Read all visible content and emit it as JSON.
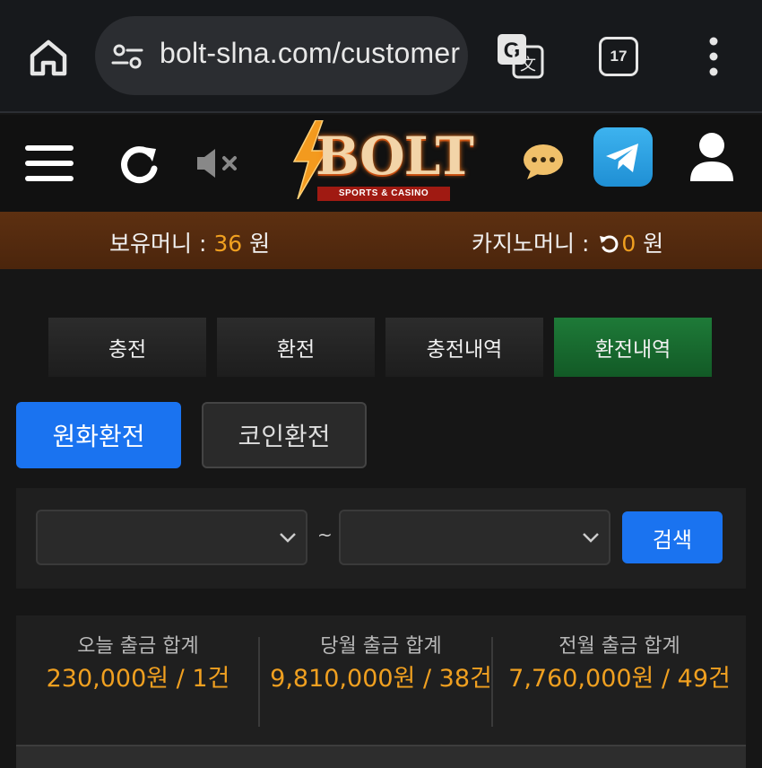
{
  "browser": {
    "url": "bolt-slna.com/customer",
    "tab_count": "17"
  },
  "header": {
    "logo_text": "BOLT",
    "logo_sub": "SPORTS & CASINO"
  },
  "balance": {
    "money_label": "보유머니 : ",
    "money_value": "36",
    "money_unit": " 원",
    "casino_label": "카지노머니 : ",
    "casino_value": "0",
    "casino_unit": " 원"
  },
  "tabs": [
    {
      "label": "충전"
    },
    {
      "label": "환전"
    },
    {
      "label": "충전내역"
    },
    {
      "label": "환전내역"
    }
  ],
  "active_tab": "환전내역",
  "subtabs": {
    "won": "원화환전",
    "coin": "코인환전"
  },
  "filter": {
    "from_value": "",
    "to_value": "",
    "separator": "~",
    "search_label": "검색"
  },
  "stats": [
    {
      "label": "오늘 출금 합계",
      "value": "230,000원 / 1건"
    },
    {
      "label": "당월 출금 합계",
      "value": "9,810,000원 / 38건"
    },
    {
      "label": "전월 출금 합계",
      "value": "7,760,000원 / 49건"
    }
  ],
  "colors": {
    "accent_blue": "#1a73f0",
    "active_green": "#1e7a38",
    "amount_orange": "#f0a020",
    "balance_bar": "#5d3011"
  }
}
